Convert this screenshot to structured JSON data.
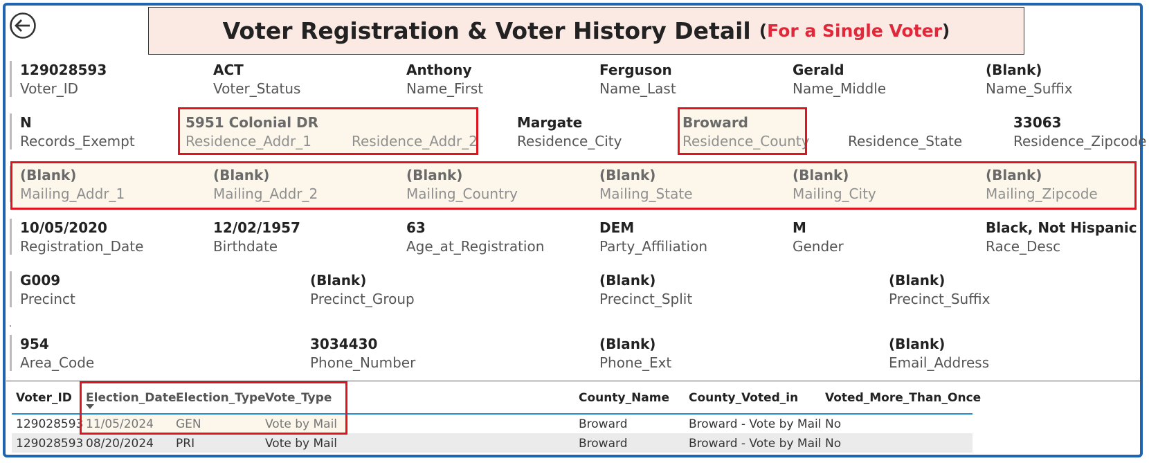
{
  "title": {
    "main": "Voter Registration & Voter History Detail",
    "open": "(",
    "sub": "For a Single Voter",
    "close": ")"
  },
  "row1": [
    {
      "value": "129028593",
      "label": "Voter_ID"
    },
    {
      "value": "ACT",
      "label": "Voter_Status"
    },
    {
      "value": "Anthony",
      "label": "Name_First"
    },
    {
      "value": "Ferguson",
      "label": "Name_Last"
    },
    {
      "value": "Gerald",
      "label": "Name_Middle"
    },
    {
      "value": "(Blank)",
      "label": "Name_Suffix"
    }
  ],
  "row2": [
    {
      "value": "N",
      "label": "Records_Exempt"
    },
    {
      "value": "5951 Colonial DR",
      "label": "Residence_Addr_1"
    },
    {
      "value": "",
      "label": "Residence_Addr_2"
    },
    {
      "value": "Margate",
      "label": "Residence_City"
    },
    {
      "value": "Broward",
      "label": "Residence_County"
    },
    {
      "value": "",
      "label": "Residence_State"
    },
    {
      "value": "33063",
      "label": "Residence_Zipcode"
    }
  ],
  "row3": [
    {
      "value": "(Blank)",
      "label": "Mailing_Addr_1"
    },
    {
      "value": "(Blank)",
      "label": "Mailing_Addr_2"
    },
    {
      "value": "(Blank)",
      "label": "Mailing_Country"
    },
    {
      "value": "(Blank)",
      "label": "Mailing_State"
    },
    {
      "value": "(Blank)",
      "label": "Mailing_City"
    },
    {
      "value": "(Blank)",
      "label": "Mailing_Zipcode"
    }
  ],
  "row4": [
    {
      "value": "10/05/2020",
      "label": "Registration_Date"
    },
    {
      "value": "12/02/1957",
      "label": "Birthdate"
    },
    {
      "value": "63",
      "label": "Age_at_Registration"
    },
    {
      "value": "DEM",
      "label": "Party_Affiliation"
    },
    {
      "value": "M",
      "label": "Gender"
    },
    {
      "value": "Black, Not Hispanic",
      "label": "Race_Desc"
    }
  ],
  "row5": [
    {
      "value": "G009",
      "label": "Precinct"
    },
    {
      "value": "(Blank)",
      "label": "Precinct_Group"
    },
    {
      "value": "(Blank)",
      "label": "Precinct_Split"
    },
    {
      "value": "(Blank)",
      "label": "Precinct_Suffix"
    }
  ],
  "row6": [
    {
      "value": "954",
      "label": "Area_Code"
    },
    {
      "value": "3034430",
      "label": "Phone_Number"
    },
    {
      "value": "(Blank)",
      "label": "Phone_Ext"
    },
    {
      "value": "(Blank)",
      "label": "Email_Address"
    }
  ],
  "history": {
    "columns": [
      "Voter_ID",
      "Election_Date",
      "Election_Type",
      "Vote_Type",
      "County_Name",
      "County_Voted_in",
      "Voted_More_Than_Once"
    ],
    "rows": [
      [
        "129028593",
        "11/05/2024",
        "GEN",
        "Vote by Mail",
        "Broward",
        "Broward - Vote by Mail",
        "No"
      ],
      [
        "129028593",
        "08/20/2024",
        "PRI",
        "Vote by Mail",
        "Broward",
        "Broward - Vote by Mail",
        "No"
      ]
    ]
  },
  "colors": {
    "frame": "#1f64b1",
    "title_bg": "#fbe9e4",
    "accent_red": "#e0283a",
    "highlight_box": "#e0141e",
    "highlight_bg": "#fcf7ea"
  }
}
